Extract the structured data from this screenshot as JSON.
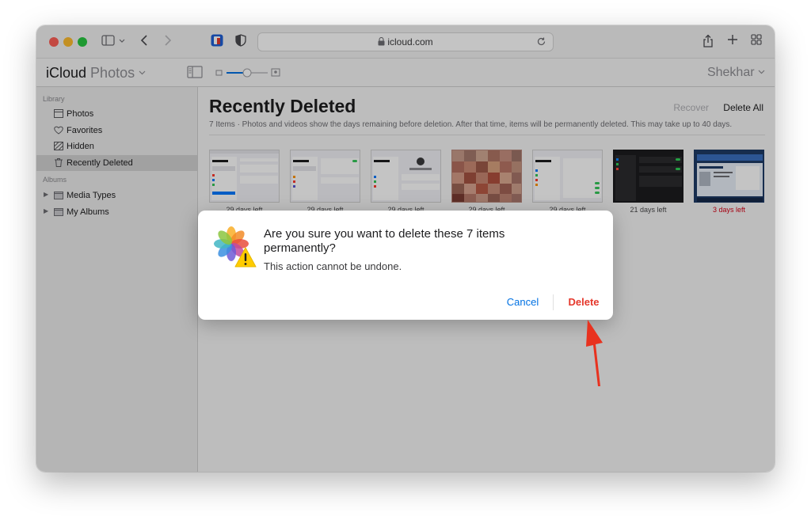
{
  "browser": {
    "url": "icloud.com"
  },
  "app": {
    "title_main": "iCloud",
    "title_sub": "Photos",
    "user": "Shekhar"
  },
  "sidebar": {
    "library_header": "Library",
    "albums_header": "Albums",
    "items": [
      {
        "label": "Photos",
        "icon": "photos-icon"
      },
      {
        "label": "Favorites",
        "icon": "heart-icon"
      },
      {
        "label": "Hidden",
        "icon": "hidden-icon"
      },
      {
        "label": "Recently Deleted",
        "icon": "trash-icon",
        "selected": true
      }
    ],
    "albums": [
      {
        "label": "Media Types",
        "icon": "folder-icon"
      },
      {
        "label": "My Albums",
        "icon": "folder-icon"
      }
    ]
  },
  "main": {
    "title": "Recently Deleted",
    "recover_label": "Recover",
    "delete_all_label": "Delete All",
    "subtitle": "7 Items  ·  Photos and videos show the days remaining before deletion. After that time, items will be permanently deleted. This may take up to 40 days.",
    "thumbnails": [
      {
        "caption": "29 days left"
      },
      {
        "caption": "29 days left"
      },
      {
        "caption": "29 days left"
      },
      {
        "caption": "29 days left"
      },
      {
        "caption": "29 days left"
      },
      {
        "caption": "21 days left"
      },
      {
        "caption": "3 days left",
        "urgent": true
      }
    ]
  },
  "dialog": {
    "title": "Are you sure you want to delete these 7 items permanently?",
    "message": "This action cannot be undone.",
    "cancel_label": "Cancel",
    "delete_label": "Delete"
  },
  "colors": {
    "accent": "#0071e3",
    "destructive": "#e5382c",
    "annotation_arrow": "#e8321f"
  }
}
